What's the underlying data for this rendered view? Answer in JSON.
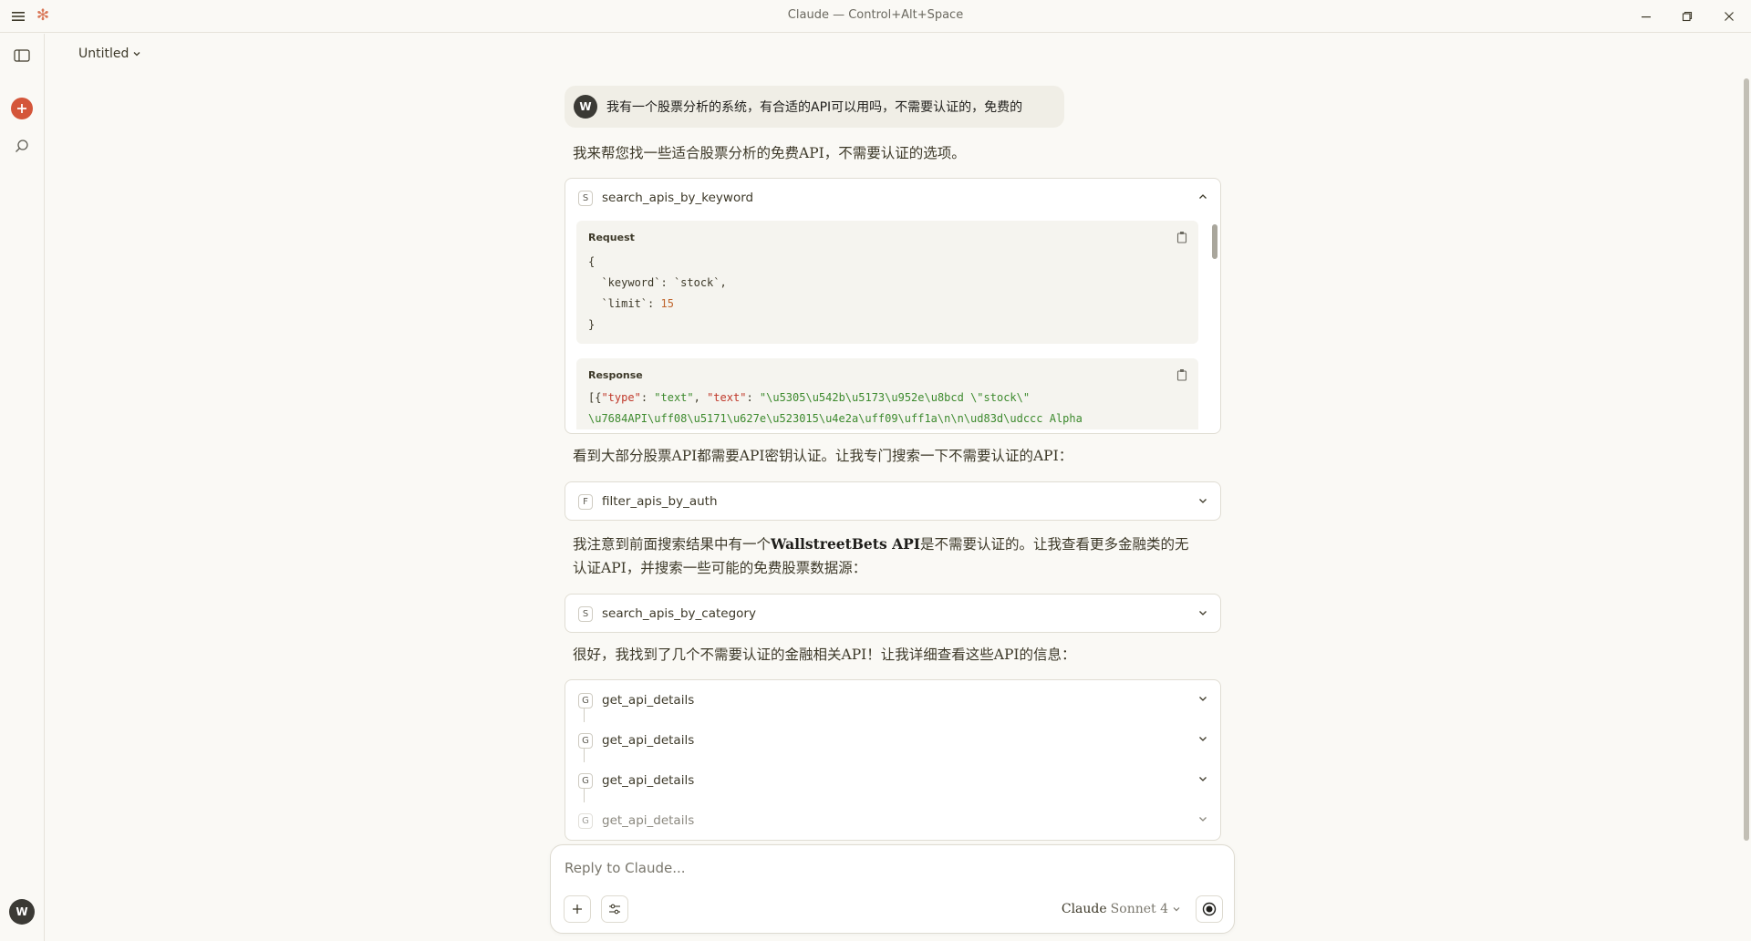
{
  "window": {
    "title": "Claude — Control+Alt+Space"
  },
  "header": {
    "conversation_title": "Untitled"
  },
  "user_message": {
    "avatar_initial": "W",
    "text": "我有一个股票分析的系统，有合适的API可以用吗，不需要认证的，免费的"
  },
  "assistant": {
    "intro": "我来帮您找一些适合股票分析的免费API，不需要认证的选项。",
    "after_first_tool": "看到大部分股票API都需要API密钥认证。让我专门搜索一下不需要认证的API：",
    "after_filter_part1": "我注意到前面搜索结果中有一个",
    "after_filter_bold": "WallstreetBets API",
    "after_filter_part2": "是不需要认证的。让我查看更多金融类的无",
    "after_filter_line2": "认证API，并搜索一些可能的免费股票数据源：",
    "after_category": "很好，我找到了几个不需要认证的金融相关API！让我详细查看这些API的信息："
  },
  "tools": {
    "search_keyword": {
      "badge": "S",
      "name": "search_apis_by_keyword",
      "request_label": "Request",
      "response_label": "Response",
      "request_lines": [
        "{",
        "  `keyword`: `stock`,",
        "  `limit`: 15",
        "}"
      ],
      "request_keyword_key": "`keyword`",
      "request_keyword_value": "`stock`",
      "request_limit_key": "`limit`",
      "request_limit_value": "15",
      "response_line1_a": "[{",
      "response_type_key": "\"type\"",
      "response_type_value": "\"text\"",
      "response_text_key": "\"text\"",
      "response_text_value": "\"\\u5305\\u542b\\u5173\\u952e\\u8bcd \\\"stock\\\"",
      "response_line2": "\\u7684API\\uff08\\u5171\\u627e\\u523015\\u4e2a\\uff09\\uff1a\\n\\n\\ud83d\\udccc Alpha"
    },
    "filter_auth": {
      "badge": "F",
      "name": "filter_apis_by_auth"
    },
    "search_category": {
      "badge": "S",
      "name": "search_apis_by_category"
    },
    "details": [
      {
        "badge": "G",
        "name": "get_api_details"
      },
      {
        "badge": "G",
        "name": "get_api_details"
      },
      {
        "badge": "G",
        "name": "get_api_details"
      },
      {
        "badge": "G",
        "name": "get_api_details"
      }
    ]
  },
  "composer": {
    "placeholder": "Reply to Claude...",
    "model_name": "Claude",
    "model_version": "Sonnet 4"
  },
  "rail": {
    "user_initial": "W"
  },
  "colors": {
    "accent": "#d97757",
    "new_chat": "#d4563a",
    "background": "#faf9f5"
  },
  "icons": [
    "menu-icon",
    "claude-logo-icon",
    "minimize-icon",
    "maximize-icon",
    "close-icon",
    "sidebar-toggle-icon",
    "plus-icon",
    "search-icon",
    "chevron-down-icon",
    "chevron-up-icon",
    "copy-icon",
    "sliders-icon",
    "record-icon"
  ]
}
